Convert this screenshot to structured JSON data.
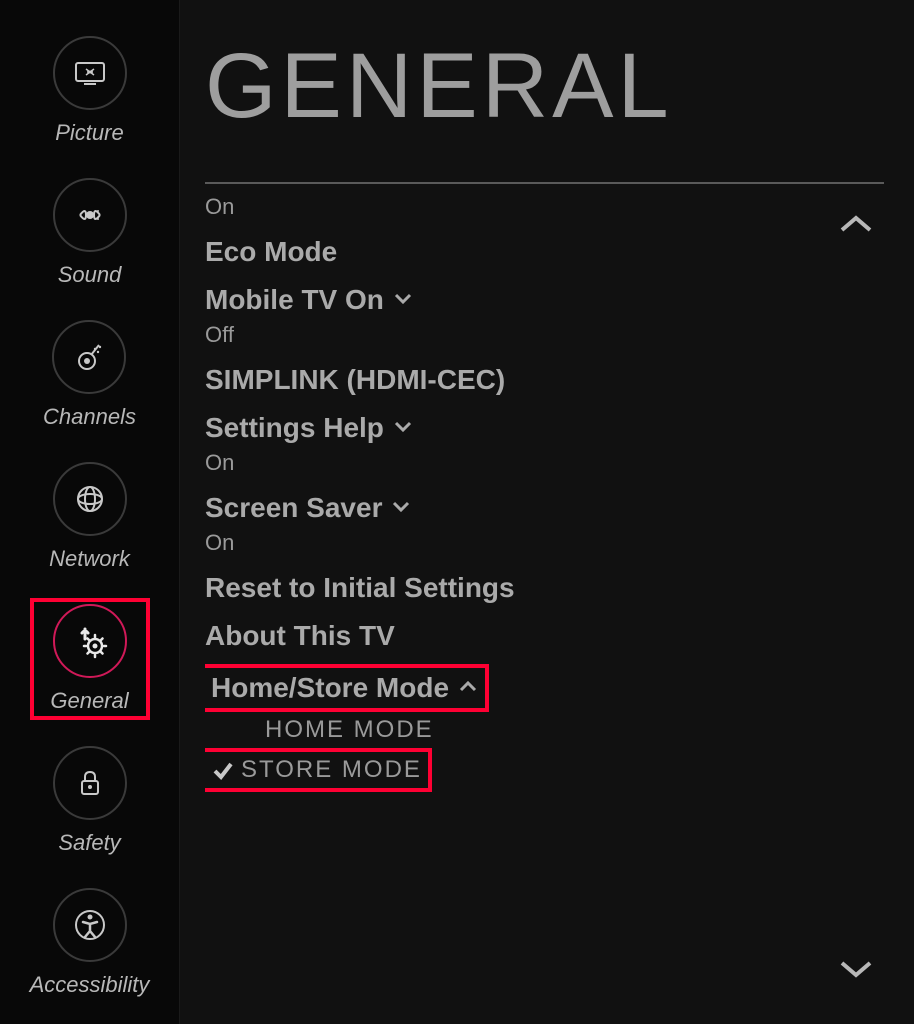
{
  "colors": {
    "accent": "#d01958",
    "highlight": "#ff0033",
    "bg": "#0a0a0a",
    "text": "#b8b8b8"
  },
  "sidebar": {
    "items": [
      {
        "label": "Picture",
        "icon": "picture-icon"
      },
      {
        "label": "Sound",
        "icon": "sound-icon"
      },
      {
        "label": "Channels",
        "icon": "channels-icon"
      },
      {
        "label": "Network",
        "icon": "network-icon"
      },
      {
        "label": "General",
        "icon": "general-icon",
        "active": true
      },
      {
        "label": "Safety",
        "icon": "safety-icon"
      },
      {
        "label": "Accessibility",
        "icon": "accessibility-icon"
      }
    ]
  },
  "main": {
    "title": "GENERAL",
    "top_value": "On",
    "rows": {
      "eco_mode": {
        "label": "Eco Mode"
      },
      "mobile_tv": {
        "label": "Mobile TV On",
        "value": "Off"
      },
      "simplink": {
        "label": "SIMPLINK (HDMI-CEC)"
      },
      "settings_help": {
        "label": "Settings Help",
        "value": "On"
      },
      "screen_saver": {
        "label": "Screen Saver",
        "value": "On"
      },
      "reset": {
        "label": "Reset to Initial Settings"
      },
      "about": {
        "label": "About This TV"
      },
      "home_store": {
        "label": "Home/Store Mode",
        "options": [
          {
            "label": "HOME MODE",
            "checked": false
          },
          {
            "label": "STORE MODE",
            "checked": true
          }
        ]
      }
    }
  }
}
